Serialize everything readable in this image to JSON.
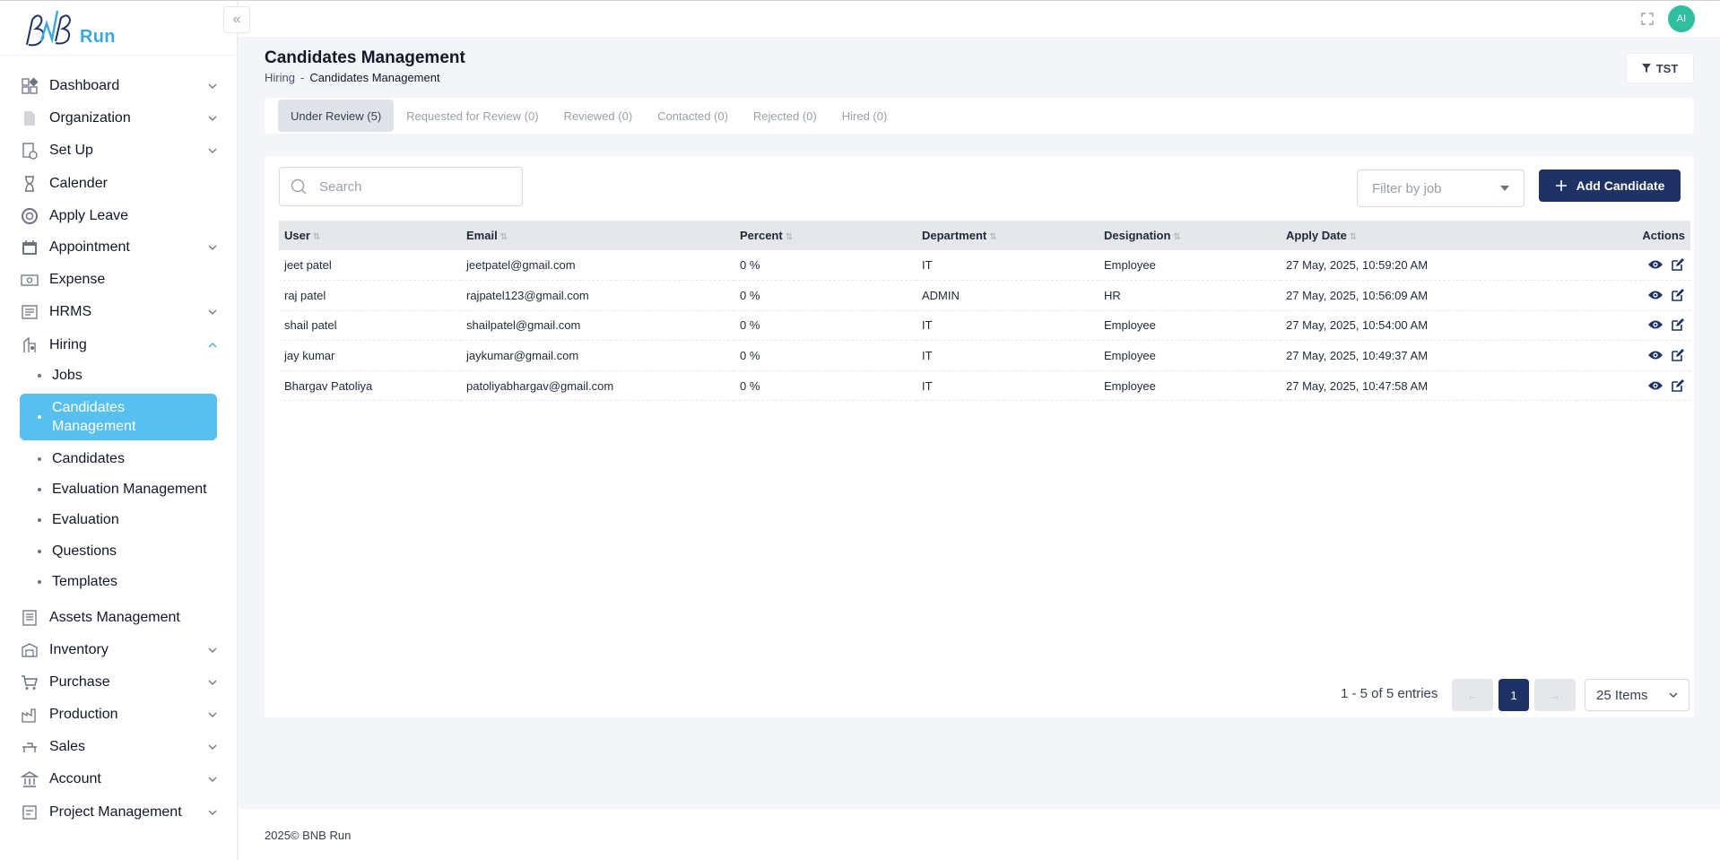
{
  "brand": {
    "name": "BNB Run",
    "logo_text": "Run"
  },
  "header": {
    "avatar_initials": "AI"
  },
  "sidebar": {
    "items": [
      {
        "label": "Dashboard",
        "icon": "dashboard-icon",
        "has_chevron": true
      },
      {
        "label": "Organization",
        "icon": "document-icon",
        "has_chevron": true
      },
      {
        "label": "Set Up",
        "icon": "setup-icon",
        "has_chevron": true
      },
      {
        "label": "Calender",
        "icon": "hourglass-icon",
        "has_chevron": false
      },
      {
        "label": "Apply Leave",
        "icon": "lifebuoy-icon",
        "has_chevron": false
      },
      {
        "label": "Appointment",
        "icon": "calendar-icon",
        "has_chevron": true
      },
      {
        "label": "Expense",
        "icon": "money-icon",
        "has_chevron": false
      },
      {
        "label": "HRMS",
        "icon": "hrms-icon",
        "has_chevron": true
      },
      {
        "label": "Hiring",
        "icon": "hiring-icon",
        "has_chevron": true,
        "expanded": true
      },
      {
        "label": "Assets Management",
        "icon": "assets-icon",
        "has_chevron": false
      },
      {
        "label": "Inventory",
        "icon": "inventory-icon",
        "has_chevron": true
      },
      {
        "label": "Purchase",
        "icon": "cart-icon",
        "has_chevron": true
      },
      {
        "label": "Production",
        "icon": "factory-icon",
        "has_chevron": true
      },
      {
        "label": "Sales",
        "icon": "sales-icon",
        "has_chevron": true
      },
      {
        "label": "Account",
        "icon": "bank-icon",
        "has_chevron": true
      },
      {
        "label": "Project Management",
        "icon": "project-icon",
        "has_chevron": true
      }
    ],
    "hiring_sub": [
      "Jobs",
      "Candidates Management",
      "Candidates",
      "Evaluation Management",
      "Evaluation",
      "Questions",
      "Templates"
    ],
    "active_sub": "Candidates Management"
  },
  "page": {
    "title": "Candidates Management",
    "breadcrumb_parent": "Hiring",
    "breadcrumb_sep": "-",
    "breadcrumb_current": "Candidates Management",
    "filter_button": "TST"
  },
  "tabs": [
    "Under Review (5)",
    "Requested for Review (0)",
    "Reviewed (0)",
    "Contacted (0)",
    "Rejected (0)",
    "Hired (0)"
  ],
  "toolbar": {
    "search_placeholder": "Search",
    "filter_placeholder": "Filter by job",
    "add_label": "Add Candidate"
  },
  "table": {
    "columns": [
      "User",
      "Email",
      "Percent",
      "Department",
      "Designation",
      "Apply Date",
      "Actions"
    ],
    "rows": [
      [
        "jeet patel",
        "jeetpatel@gmail.com",
        "0 %",
        "IT",
        "Employee",
        "27 May, 2025, 10:59:20 AM"
      ],
      [
        "raj patel",
        "rajpatel123@gmail.com",
        "0 %",
        "ADMIN",
        "HR",
        "27 May, 2025, 10:56:09 AM"
      ],
      [
        "shail patel",
        "shailpatel@gmail.com",
        "0 %",
        "IT",
        "Employee",
        "27 May, 2025, 10:54:00 AM"
      ],
      [
        "jay kumar",
        "jaykumar@gmail.com",
        "0 %",
        "IT",
        "Employee",
        "27 May, 2025, 10:49:37 AM"
      ],
      [
        "Bhargav Patoliya",
        "patoliyabhargav@gmail.com",
        "0 %",
        "IT",
        "Employee",
        "27 May, 2025, 10:47:58 AM"
      ]
    ]
  },
  "pagination": {
    "entries": "1 - 5 of 5 entries",
    "prev": "←",
    "current": "1",
    "next": "→",
    "per_page": "25 Items"
  },
  "footer": {
    "text": "2025© BNB Run"
  },
  "colors": {
    "primary": "#1f3266",
    "active": "#58c0ee",
    "avatar": "#2fbf9f",
    "brand": "#3aa9e0"
  }
}
